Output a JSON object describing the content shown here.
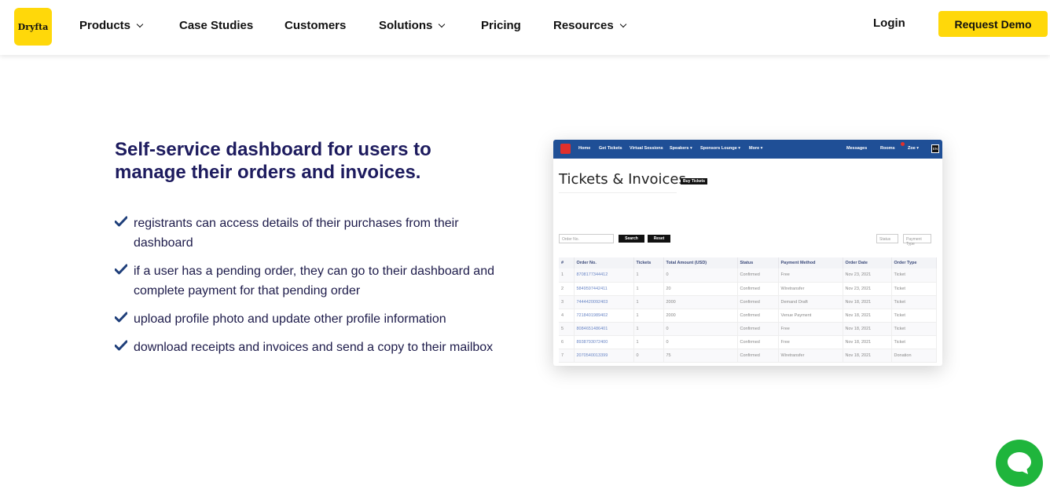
{
  "brand": {
    "logo_text": "Dryfta"
  },
  "nav": {
    "items": [
      {
        "label": "Products",
        "has_dropdown": true
      },
      {
        "label": "Case Studies",
        "has_dropdown": false
      },
      {
        "label": "Customers",
        "has_dropdown": false
      },
      {
        "label": "Solutions",
        "has_dropdown": true
      },
      {
        "label": "Pricing",
        "has_dropdown": false
      },
      {
        "label": "Resources",
        "has_dropdown": true
      }
    ],
    "login": "Login",
    "cta": "Request Demo"
  },
  "section": {
    "headline": "Self-service dashboard for users to manage their orders and invoices.",
    "features": [
      "registrants can access details of their purchases from their dashboard",
      "if a user has a pending order, they can go to their dashboard and complete payment for that pending order",
      "upload profile photo and update other profile information",
      "download receipts and invoices and send a copy to their mailbox"
    ]
  },
  "preview": {
    "nav": [
      "Home",
      "Get Tickets",
      "Virtual Sessions",
      "Speakers ▾",
      "Sponsors Lounge ▾",
      "More ▾"
    ],
    "right_nav": [
      "Messages",
      "Rooms",
      "Zoe ▾"
    ],
    "lang": "EN",
    "title": "Tickets & Invoices",
    "buy_button": "Buy Tickets",
    "order_placeholder": "Order No.",
    "search_button": "Search",
    "reset_button": "Reset",
    "status_filter": "Status",
    "payment_filter": "Payment Type",
    "columns": [
      "#",
      "Order No.",
      "Tickets",
      "Total Amount (USD)",
      "Status",
      "Payment Method",
      "Order Date",
      "Order Type"
    ],
    "rows": [
      [
        "1",
        "8708177344412",
        "1",
        "0",
        "Confirmed",
        "Free",
        "Nov 23, 2021",
        "Ticket"
      ],
      [
        "2",
        "5849597442411",
        "1",
        "20",
        "Confirmed",
        "Wiretransfer",
        "Nov 23, 2021",
        "Ticket"
      ],
      [
        "3",
        "7444420092403",
        "1",
        "2000",
        "Confirmed",
        "Demand Draft",
        "Nov 18, 2021",
        "Ticket"
      ],
      [
        "4",
        "7218401989402",
        "1",
        "2000",
        "Confirmed",
        "Venue Payment",
        "Nov 18, 2021",
        "Ticket"
      ],
      [
        "5",
        "8084651486401",
        "1",
        "0",
        "Confirmed",
        "Free",
        "Nov 18, 2021",
        "Ticket"
      ],
      [
        "6",
        "8938793072400",
        "1",
        "0",
        "Confirmed",
        "Free",
        "Nov 18, 2021",
        "Ticket"
      ],
      [
        "7",
        "2070540013399",
        "0",
        "75",
        "Confirmed",
        "Wiretransfer",
        "Nov 18, 2021",
        "Donation"
      ]
    ]
  },
  "colors": {
    "brand_yellow": "#ffd80a",
    "headline_navy": "#1d1b5e",
    "preview_bar": "#1f4f96",
    "chat_green": "#1fb53c"
  },
  "icons": {
    "check": "check-icon",
    "chat": "chat-bubble-icon",
    "dropdown": "chevron-down-icon"
  }
}
